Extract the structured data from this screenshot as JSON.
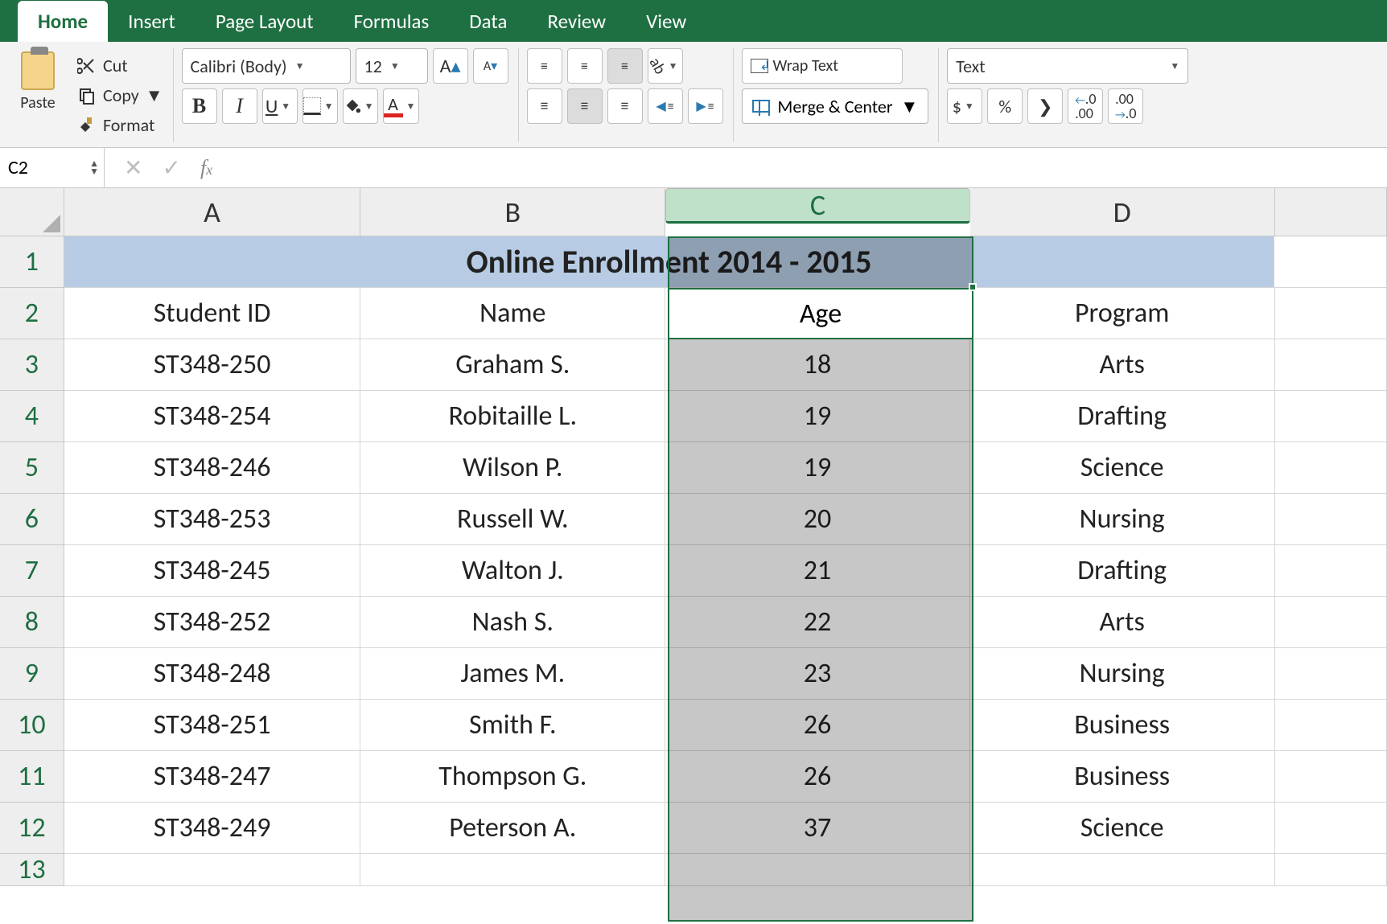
{
  "tabs": [
    "Home",
    "Insert",
    "Page Layout",
    "Formulas",
    "Data",
    "Review",
    "View"
  ],
  "activeTab": "Home",
  "clipboard": {
    "paste": "Paste",
    "cut": "Cut",
    "copy": "Copy",
    "format": "Format"
  },
  "font": {
    "name": "Calibri (Body)",
    "size": "12",
    "bold": "B",
    "italic": "I",
    "underline": "U",
    "fontColorLetter": "A"
  },
  "alignment": {
    "wrap": "Wrap Text",
    "merge": "Merge & Center"
  },
  "number": {
    "format": "Text",
    "currency": "$",
    "percent": "%",
    "comma": "❯"
  },
  "nameBox": "C2",
  "formula": "",
  "columns": [
    "A",
    "B",
    "C",
    "D"
  ],
  "rowNums": [
    "1",
    "2",
    "3",
    "4",
    "5",
    "6",
    "7",
    "8",
    "9",
    "10",
    "11",
    "12",
    "13"
  ],
  "title": "Online Enrollment 2014 - 2015",
  "headers": [
    "Student ID",
    "Name",
    "Age",
    "Program"
  ],
  "rowsData": [
    [
      "ST348-250",
      "Graham S.",
      "18",
      "Arts"
    ],
    [
      "ST348-254",
      "Robitaille L.",
      "19",
      "Drafting"
    ],
    [
      "ST348-246",
      "Wilson P.",
      "19",
      "Science"
    ],
    [
      "ST348-253",
      "Russell W.",
      "20",
      "Nursing"
    ],
    [
      "ST348-245",
      "Walton J.",
      "21",
      "Drafting"
    ],
    [
      "ST348-252",
      "Nash S.",
      "22",
      "Arts"
    ],
    [
      "ST348-248",
      "James M.",
      "23",
      "Nursing"
    ],
    [
      "ST348-251",
      "Smith F.",
      "26",
      "Business"
    ],
    [
      "ST348-247",
      "Thompson G.",
      "26",
      "Business"
    ],
    [
      "ST348-249",
      "Peterson A.",
      "37",
      "Science"
    ]
  ],
  "chart_data": {
    "type": "table",
    "title": "Online Enrollment 2014 - 2015",
    "columns": [
      "Student ID",
      "Name",
      "Age",
      "Program"
    ],
    "rows": [
      [
        "ST348-250",
        "Graham S.",
        18,
        "Arts"
      ],
      [
        "ST348-254",
        "Robitaille L.",
        19,
        "Drafting"
      ],
      [
        "ST348-246",
        "Wilson P.",
        19,
        "Science"
      ],
      [
        "ST348-253",
        "Russell W.",
        20,
        "Nursing"
      ],
      [
        "ST348-245",
        "Walton J.",
        21,
        "Drafting"
      ],
      [
        "ST348-252",
        "Nash S.",
        22,
        "Arts"
      ],
      [
        "ST348-248",
        "James M.",
        23,
        "Nursing"
      ],
      [
        "ST348-251",
        "Smith F.",
        26,
        "Business"
      ],
      [
        "ST348-247",
        "Thompson G.",
        26,
        "Business"
      ],
      [
        "ST348-249",
        "Peterson A.",
        37,
        "Science"
      ]
    ]
  }
}
